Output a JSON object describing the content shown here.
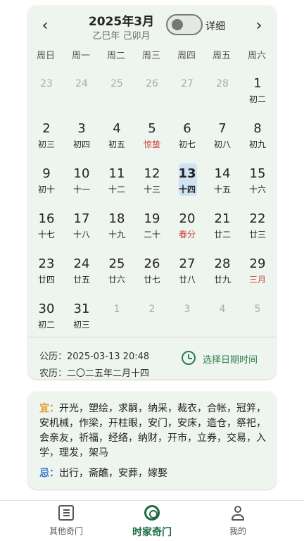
{
  "calendar": {
    "title": "2025年3月",
    "subtitle": "乙巳年 己卯月",
    "prev_icon": "chevron-left-icon",
    "next_icon": "chevron-right-icon",
    "toggle": {
      "label": "详细",
      "on": false
    },
    "weekdays": [
      "周日",
      "周一",
      "周二",
      "周三",
      "周四",
      "周五",
      "周六"
    ],
    "days": [
      {
        "d": "23",
        "l": "",
        "other": true
      },
      {
        "d": "24",
        "l": "",
        "other": true
      },
      {
        "d": "25",
        "l": "",
        "other": true
      },
      {
        "d": "26",
        "l": "",
        "other": true
      },
      {
        "d": "27",
        "l": "",
        "other": true
      },
      {
        "d": "28",
        "l": "",
        "other": true
      },
      {
        "d": "1",
        "l": "初二"
      },
      {
        "d": "2",
        "l": "初三"
      },
      {
        "d": "3",
        "l": "初四"
      },
      {
        "d": "4",
        "l": "初五"
      },
      {
        "d": "5",
        "l": "惊蛰",
        "term": true
      },
      {
        "d": "6",
        "l": "初七"
      },
      {
        "d": "7",
        "l": "初八"
      },
      {
        "d": "8",
        "l": "初九"
      },
      {
        "d": "9",
        "l": "初十"
      },
      {
        "d": "10",
        "l": "十一"
      },
      {
        "d": "11",
        "l": "十二"
      },
      {
        "d": "12",
        "l": "十三"
      },
      {
        "d": "13",
        "l": "十四",
        "today": true
      },
      {
        "d": "14",
        "l": "十五"
      },
      {
        "d": "15",
        "l": "十六"
      },
      {
        "d": "16",
        "l": "十七"
      },
      {
        "d": "17",
        "l": "十八"
      },
      {
        "d": "18",
        "l": "十九"
      },
      {
        "d": "19",
        "l": "二十"
      },
      {
        "d": "20",
        "l": "春分",
        "term": true
      },
      {
        "d": "21",
        "l": "廿二"
      },
      {
        "d": "22",
        "l": "廿三"
      },
      {
        "d": "23",
        "l": "廿四"
      },
      {
        "d": "24",
        "l": "廿五"
      },
      {
        "d": "25",
        "l": "廿六"
      },
      {
        "d": "26",
        "l": "廿七"
      },
      {
        "d": "27",
        "l": "廿八"
      },
      {
        "d": "28",
        "l": "廿九"
      },
      {
        "d": "29",
        "l": "三月",
        "term": true
      },
      {
        "d": "30",
        "l": "初二"
      },
      {
        "d": "31",
        "l": "初三"
      },
      {
        "d": "1",
        "l": "",
        "other": true
      },
      {
        "d": "2",
        "l": "",
        "other": true
      },
      {
        "d": "3",
        "l": "",
        "other": true
      },
      {
        "d": "4",
        "l": "",
        "other": true
      },
      {
        "d": "5",
        "l": "",
        "other": true
      }
    ],
    "solar": "公历：2025-03-13 20:48",
    "lunar": "农历：二〇二五年二月十四",
    "select_label": "选择日期时间",
    "select_icon": "clock-icon",
    "accent": "#2e7d4f",
    "today_bg": "#cfe3f5",
    "term_color": "#c8463e"
  },
  "yiji": {
    "yi_label": "宜：",
    "yi_text": "开光，塑绘，求嗣，纳采，裁衣，合帐，冠笄，安机械，作梁，开柱眼，安门，安床，造仓，祭祀，会亲友，祈福，经络，纳财，开市，立券，交易，入学，理发，架马",
    "ji_label": "忌：",
    "ji_text": "出行，斋醮，安葬，嫁娶",
    "yi_color": "#e0a030",
    "ji_color": "#3a78c9"
  },
  "nav": [
    {
      "label": "其他奇门",
      "icon": "book-icon",
      "active": false
    },
    {
      "label": "时家奇门",
      "icon": "target-icon",
      "active": true
    },
    {
      "label": "我的",
      "icon": "person-icon",
      "active": false
    }
  ]
}
